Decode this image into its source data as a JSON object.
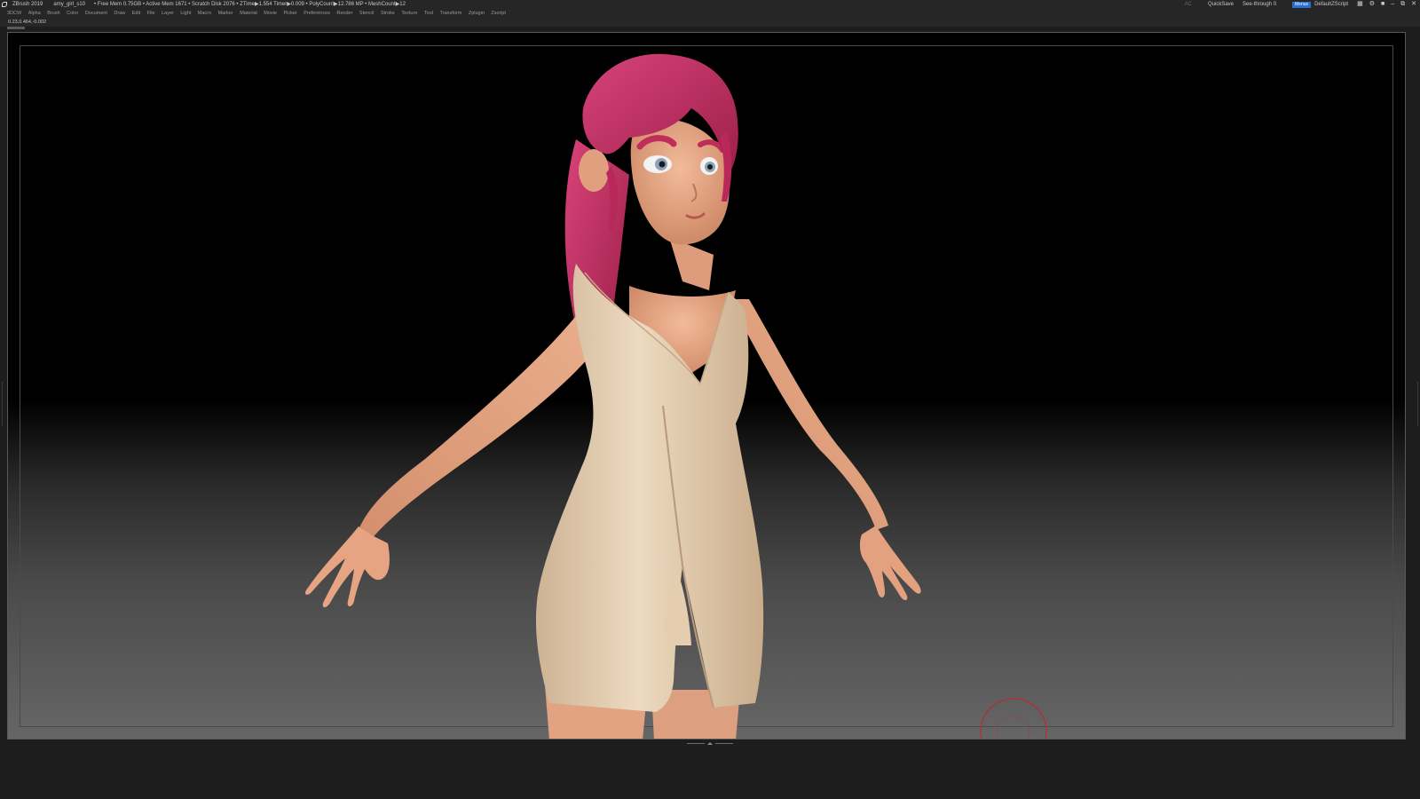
{
  "titlebar": {
    "app_title": "ZBrush 2019",
    "project": "amy_girl_s10",
    "stats": "• Free Mem 0.75GB • Active Mem 1671 • Scratch Disk 2076 •  ZTime▶1.554 Timer▶0.009 • PolyCount▶12.786 MP  • MeshCount▶12",
    "ac_label": "AC",
    "quicksave_label": "QuickSave",
    "seethrough_label": "See-through  0",
    "seethrough_value": 0,
    "menus_label": "Menus",
    "script_label": "DefaultZScript"
  },
  "menubar": {
    "items": [
      "3DCW",
      "Alpha",
      "Brush",
      "Color",
      "Document",
      "Draw",
      "Edit",
      "File",
      "Layer",
      "Light",
      "Macro",
      "Marker",
      "Material",
      "Movie",
      "Picker",
      "Preferences",
      "Render",
      "Stencil",
      "Stroke",
      "Texture",
      "Tool",
      "Transform",
      "Zplugin",
      "Zscript"
    ]
  },
  "status": {
    "coords": "0.23,0.464,-0.002"
  },
  "colors": {
    "accent": "#2a6fd0",
    "seethrough_fill": "#3fae49",
    "gyro": "#c0262b",
    "hair": "#c2305e",
    "skin": "#e8a987",
    "dress": "#e6d2b6"
  },
  "icons": [
    "zbrush-logo-icon",
    "window-layout-icon",
    "help-icon",
    "lock-icon",
    "minimize-icon",
    "restore-icon",
    "close-icon",
    "gyro-icon"
  ]
}
